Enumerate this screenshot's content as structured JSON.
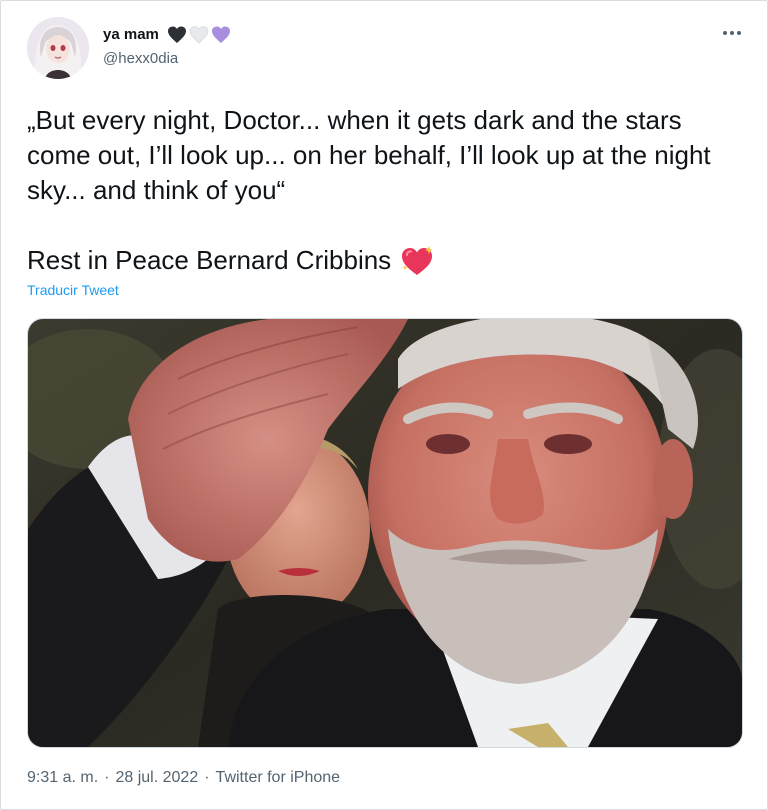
{
  "tweet": {
    "display_name": "ya mam",
    "name_emojis": [
      "black-heart",
      "white-heart",
      "purple-heart"
    ],
    "handle": "@hexx0dia",
    "text_line_1": "„But every night, Doctor... when it gets dark and the stars come out, I’ll look up... on her behalf, I’ll look up at the night sky... and think of you“",
    "text_line_2": "Rest in Peace Bernard Cribbins",
    "trailing_emoji": "sparkling-heart",
    "translate_label": "Traducir Tweet",
    "time": "9:31 a. m.",
    "separator": "·",
    "date": "28 jul. 2022",
    "source": "Twitter for iPhone"
  },
  "colors": {
    "link": "#1d9bf0",
    "secondary_text": "#536471",
    "primary_text": "#0f1419"
  },
  "icons": {
    "more": "more-options-icon"
  }
}
